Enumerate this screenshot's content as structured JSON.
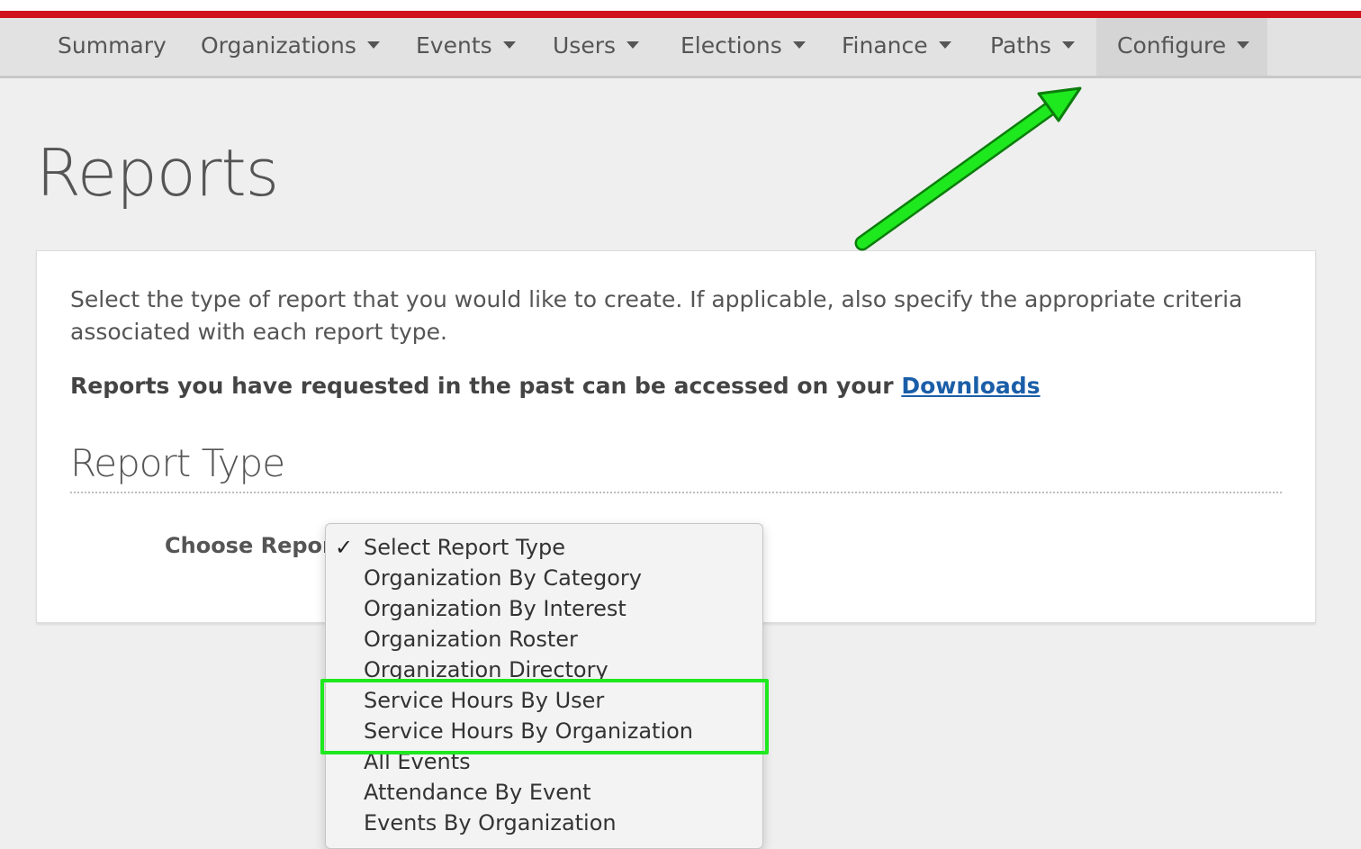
{
  "nav": {
    "items": [
      {
        "label": "Summary",
        "caret": false
      },
      {
        "label": "Organizations",
        "caret": true
      },
      {
        "label": "Events",
        "caret": true
      },
      {
        "label": "Users",
        "caret": true
      },
      {
        "label": "Elections",
        "caret": true
      },
      {
        "label": "Finance",
        "caret": true
      },
      {
        "label": "Paths",
        "caret": true
      },
      {
        "label": "Configure",
        "caret": true,
        "active": true
      }
    ]
  },
  "page": {
    "title": "Reports"
  },
  "card": {
    "intro": "Select the type of report that you would like to create. If applicable, also specify the appropriate criteria associated with each report type.",
    "past_reports_text": "Reports you have requested in the past can be accessed on your ",
    "downloads_link": "Downloads",
    "section_title": "Report Type",
    "choose_label": "Choose Report"
  },
  "dropdown": {
    "selected": "Select Report Type",
    "options": [
      "Select Report Type",
      "Organization By Category",
      "Organization By Interest",
      "Organization Roster",
      "Organization Directory",
      "Service Hours By User",
      "Service Hours By Organization",
      "All Events",
      "Attendance By Event",
      "Events By Organization"
    ]
  },
  "annotation": {
    "color": "#1ee81e",
    "highlighted_options": [
      "Service Hours By User",
      "Service Hours By Organization"
    ]
  },
  "colors": {
    "brand_red": "#d0111b",
    "link_blue": "#1a5ea8"
  }
}
